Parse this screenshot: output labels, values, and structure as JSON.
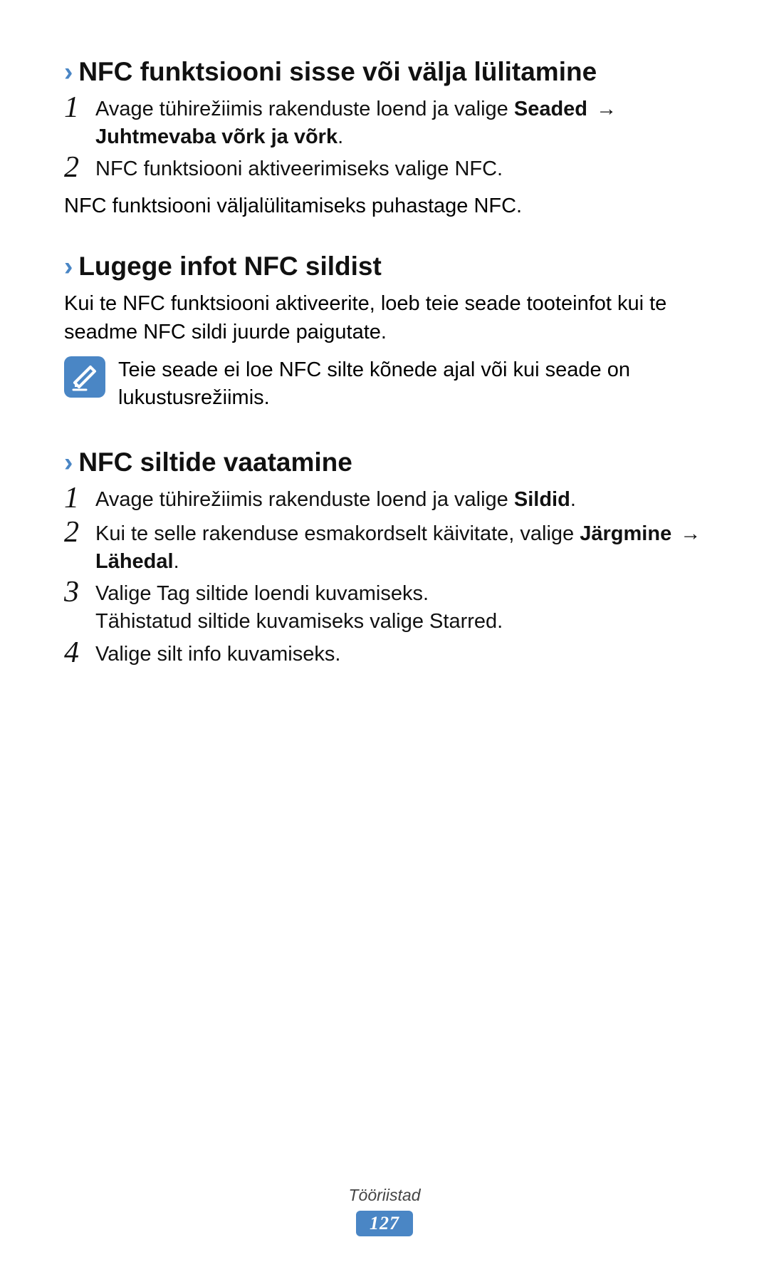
{
  "sections": [
    {
      "heading": "NFC funktsiooni sisse või välja lülitamine",
      "steps": [
        {
          "num": "1",
          "html": "Avage tühirežiimis rakenduste loend ja valige <b>Seaded</b> <span class='arrow'>→</span> <b>Juhtmevaba võrk ja võrk</b>."
        },
        {
          "num": "2",
          "html": "NFC funktsiooni aktiveerimiseks valige NFC."
        }
      ],
      "after": "NFC funktsiooni väljalülitamiseks puhastage NFC."
    },
    {
      "heading": "Lugege infot NFC sildist",
      "body": "Kui te NFC funktsiooni aktiveerite, loeb teie seade tooteinfot kui te seadme NFC sildi juurde paigutate.",
      "note": "Teie seade ei loe NFC silte kõnede ajal või kui seade on lukustusrežiimis."
    },
    {
      "heading": "NFC siltide vaatamine",
      "steps": [
        {
          "num": "1",
          "html": "Avage tühirežiimis rakenduste loend ja valige <b>Sildid</b>."
        },
        {
          "num": "2",
          "html": "Kui te selle rakenduse esmakordselt käivitate, valige <b>Järgmine</b> <span class='arrow'>→</span> <b>Lähedal</b>."
        },
        {
          "num": "3",
          "html": "Valige Tag siltide loendi kuvamiseks.<br>Tähistatud siltide kuvamiseks valige Starred."
        },
        {
          "num": "4",
          "html": "Valige silt info kuvamiseks."
        }
      ]
    }
  ],
  "footer": {
    "category": "Tööriistad",
    "page": "127"
  }
}
